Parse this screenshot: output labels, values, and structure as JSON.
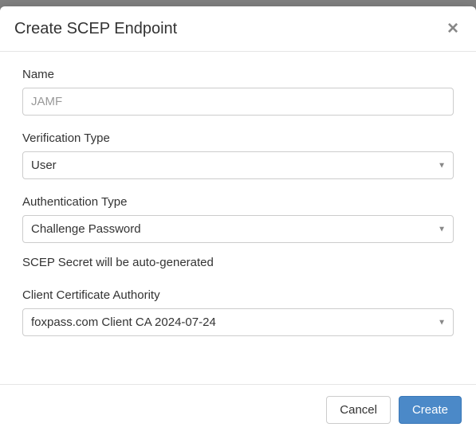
{
  "modal": {
    "title": "Create SCEP Endpoint"
  },
  "form": {
    "name": {
      "label": "Name",
      "placeholder": "JAMF",
      "value": ""
    },
    "verification_type": {
      "label": "Verification Type",
      "selected": "User"
    },
    "authentication_type": {
      "label": "Authentication Type",
      "selected": "Challenge Password"
    },
    "secret_hint": "SCEP Secret will be auto-generated",
    "client_ca": {
      "label": "Client Certificate Authority",
      "selected": "foxpass.com Client CA 2024-07-24"
    }
  },
  "footer": {
    "cancel": "Cancel",
    "create": "Create"
  }
}
